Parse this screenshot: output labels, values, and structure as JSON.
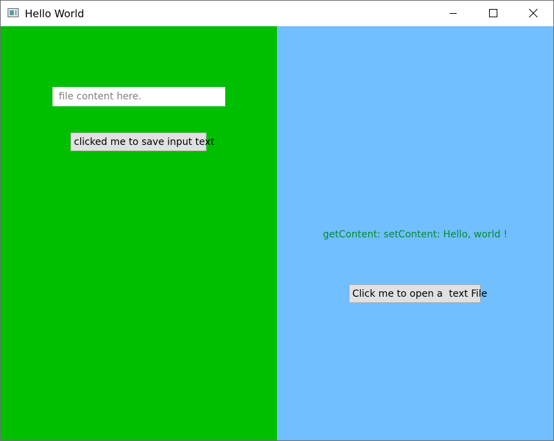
{
  "window": {
    "title": "Hello World",
    "app_icon": "window-app-icon",
    "controls": {
      "minimize_icon": "minimize-icon",
      "maximize_icon": "maximize-icon",
      "close_icon": "close-icon"
    }
  },
  "left_panel": {
    "background": "#00bf00",
    "input": {
      "value": "",
      "placeholder": "file content here."
    },
    "save_button_label": "clicked me to save input text"
  },
  "right_panel": {
    "background": "#71bfff",
    "content_label": "getContent: setContent: Hello, world !",
    "content_label_color": "#008c2e",
    "open_button_label": "Click me to open a  text File"
  }
}
